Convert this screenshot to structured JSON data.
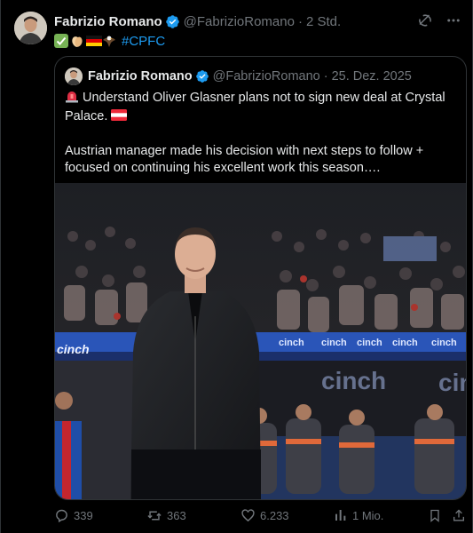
{
  "author": {
    "name": "Fabrizio Romano",
    "handle": "@FabrizioRomano",
    "time": "2 Std."
  },
  "post": {
    "hashtag": "#CPFC",
    "emojis": [
      "check-mark-emoji",
      "clapping-hands-emoji",
      "germany-flag-emoji",
      "eagle-emoji"
    ]
  },
  "quoted": {
    "name": "Fabrizio Romano",
    "handle": "@FabrizioRomano",
    "date": "25. Dez. 2025",
    "line1": "Understand Oliver Glasner plans not to sign new deal at Crystal Palace.",
    "line2": "Austrian manager made his decision with next steps to follow + focused on continuing his excellent work this season….",
    "photo_banner_text": "cinch"
  },
  "stats": {
    "replies": "339",
    "reposts": "363",
    "likes": "6.233",
    "views": "1 Mio."
  },
  "colors": {
    "accent": "#1d9bf0",
    "muted": "#71767b",
    "border": "#2f3336"
  }
}
